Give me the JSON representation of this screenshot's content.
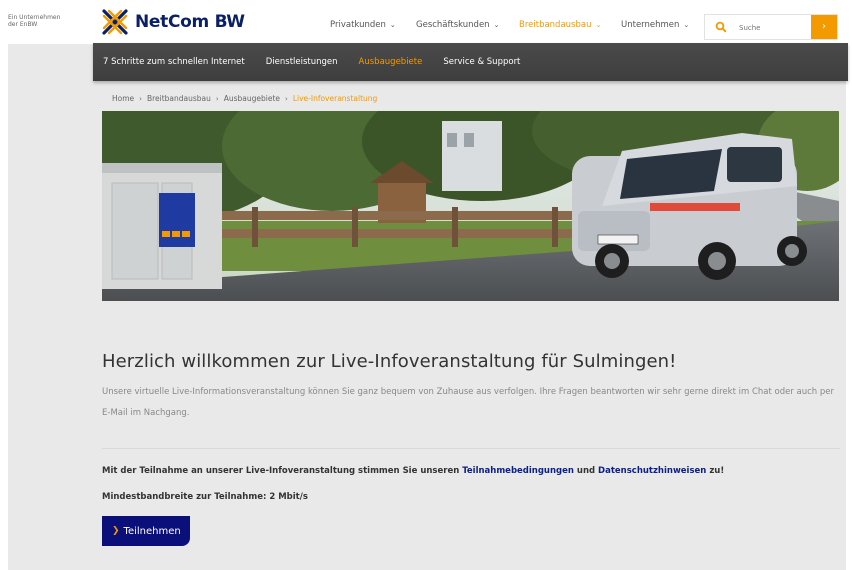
{
  "header": {
    "parent_line1": "Ein Unternehmen",
    "parent_line2": "der EnBW",
    "logo_text": "NetCom BW",
    "nav": [
      {
        "label": "Privatkunden",
        "active": false
      },
      {
        "label": "Geschäftskunden",
        "active": false
      },
      {
        "label": "Breitbandausbau",
        "active": true
      },
      {
        "label": "Unternehmen",
        "active": false
      }
    ],
    "search": {
      "placeholder": "Suche",
      "icon": "search-icon",
      "submit_icon": "chevron-right-icon"
    }
  },
  "subnav": {
    "items": [
      {
        "label": "7 Schritte zum schnellen Internet",
        "active": false
      },
      {
        "label": "Dienstleistungen",
        "active": false
      },
      {
        "label": "Ausbaugebiete",
        "active": true
      },
      {
        "label": "Service & Support",
        "active": false
      }
    ]
  },
  "breadcrumb": [
    "Home",
    "Breitbandausbau",
    "Ausbaugebiete",
    "Live-Infoveranstaltung"
  ],
  "main": {
    "title": "Herzlich willkommen zur Live-Infoveranstaltung für Sulmingen!",
    "intro": "Unsere virtuelle Live-Informationsveranstaltung können Sie ganz bequem von Zuhause aus verfolgen. Ihre Fragen beantworten wir sehr gerne direkt im Chat oder auch per E-Mail im Nachgang.",
    "consent_before": "Mit der Teilnahme an unserer Live-Infoveranstaltung stimmen Sie unseren ",
    "consent_link1": "Teilnahmebedingungen",
    "consent_middle": " und ",
    "consent_link2": "Datenschutzhinweisen",
    "consent_after": " zu!",
    "bandwidth": "Mindestbandbreite zur Teilnahme: 2 Mbit/s",
    "button_label": "Teilnehmen"
  },
  "colors": {
    "brand": "#0b1f66",
    "accent": "#f29a00",
    "button": "#0b0f7a",
    "subnav": "#444444",
    "page_bg": "#e9e9e9"
  }
}
